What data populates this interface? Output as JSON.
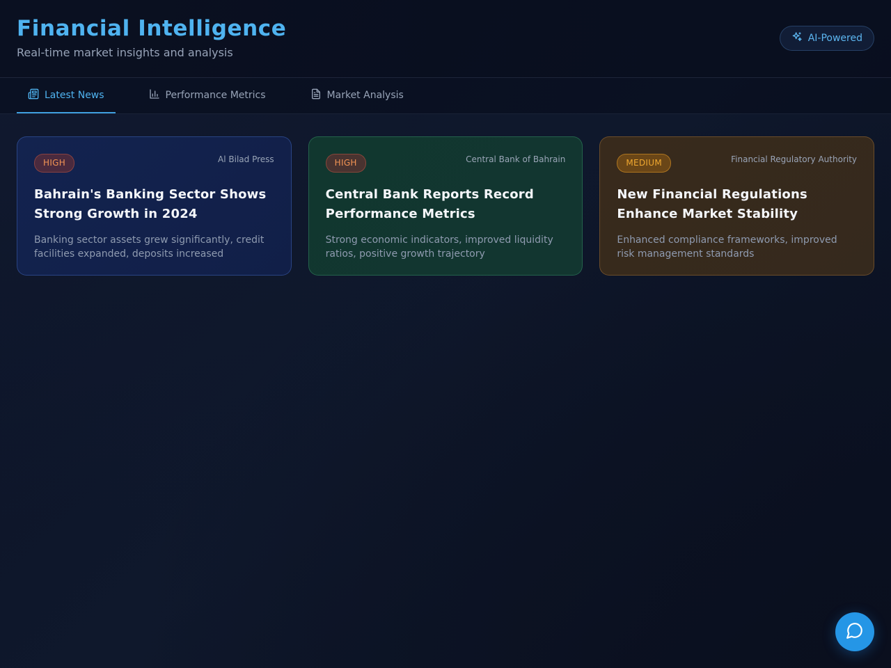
{
  "header": {
    "title": "Financial Intelligence",
    "subtitle": "Real-time market insights and analysis",
    "badge_label": "AI-Powered",
    "badge_icon": "sparkles-icon"
  },
  "tabs": [
    {
      "label": "Latest News",
      "icon": "newspaper-icon",
      "active": true
    },
    {
      "label": "Performance Metrics",
      "icon": "bar-chart-icon",
      "active": false
    },
    {
      "label": "Market Analysis",
      "icon": "document-icon",
      "active": false
    }
  ],
  "cards": [
    {
      "priority": "HIGH",
      "source": "Al Bilad Press",
      "title": "Bahrain's Banking Sector Shows Strong Growth in 2024",
      "summary": "Banking sector assets grew significantly, credit facilities expanded, deposits increased",
      "theme": "blue"
    },
    {
      "priority": "HIGH",
      "source": "Central Bank of Bahrain",
      "title": "Central Bank Reports Record Performance Metrics",
      "summary": "Strong economic indicators, improved liquidity ratios, positive growth trajectory",
      "theme": "green"
    },
    {
      "priority": "MEDIUM",
      "source": "Financial Regulatory Authority",
      "title": "New Financial Regulations Enhance Market Stability",
      "summary": "Enhanced compliance frameworks, improved risk management standards",
      "theme": "amber"
    }
  ],
  "chat_button": {
    "icon": "chat-bubble-icon"
  },
  "colors": {
    "accent": "#4fb3f0",
    "fab": "#2596e6",
    "high_badge": "#f29454",
    "medium_badge": "#f0a830"
  }
}
